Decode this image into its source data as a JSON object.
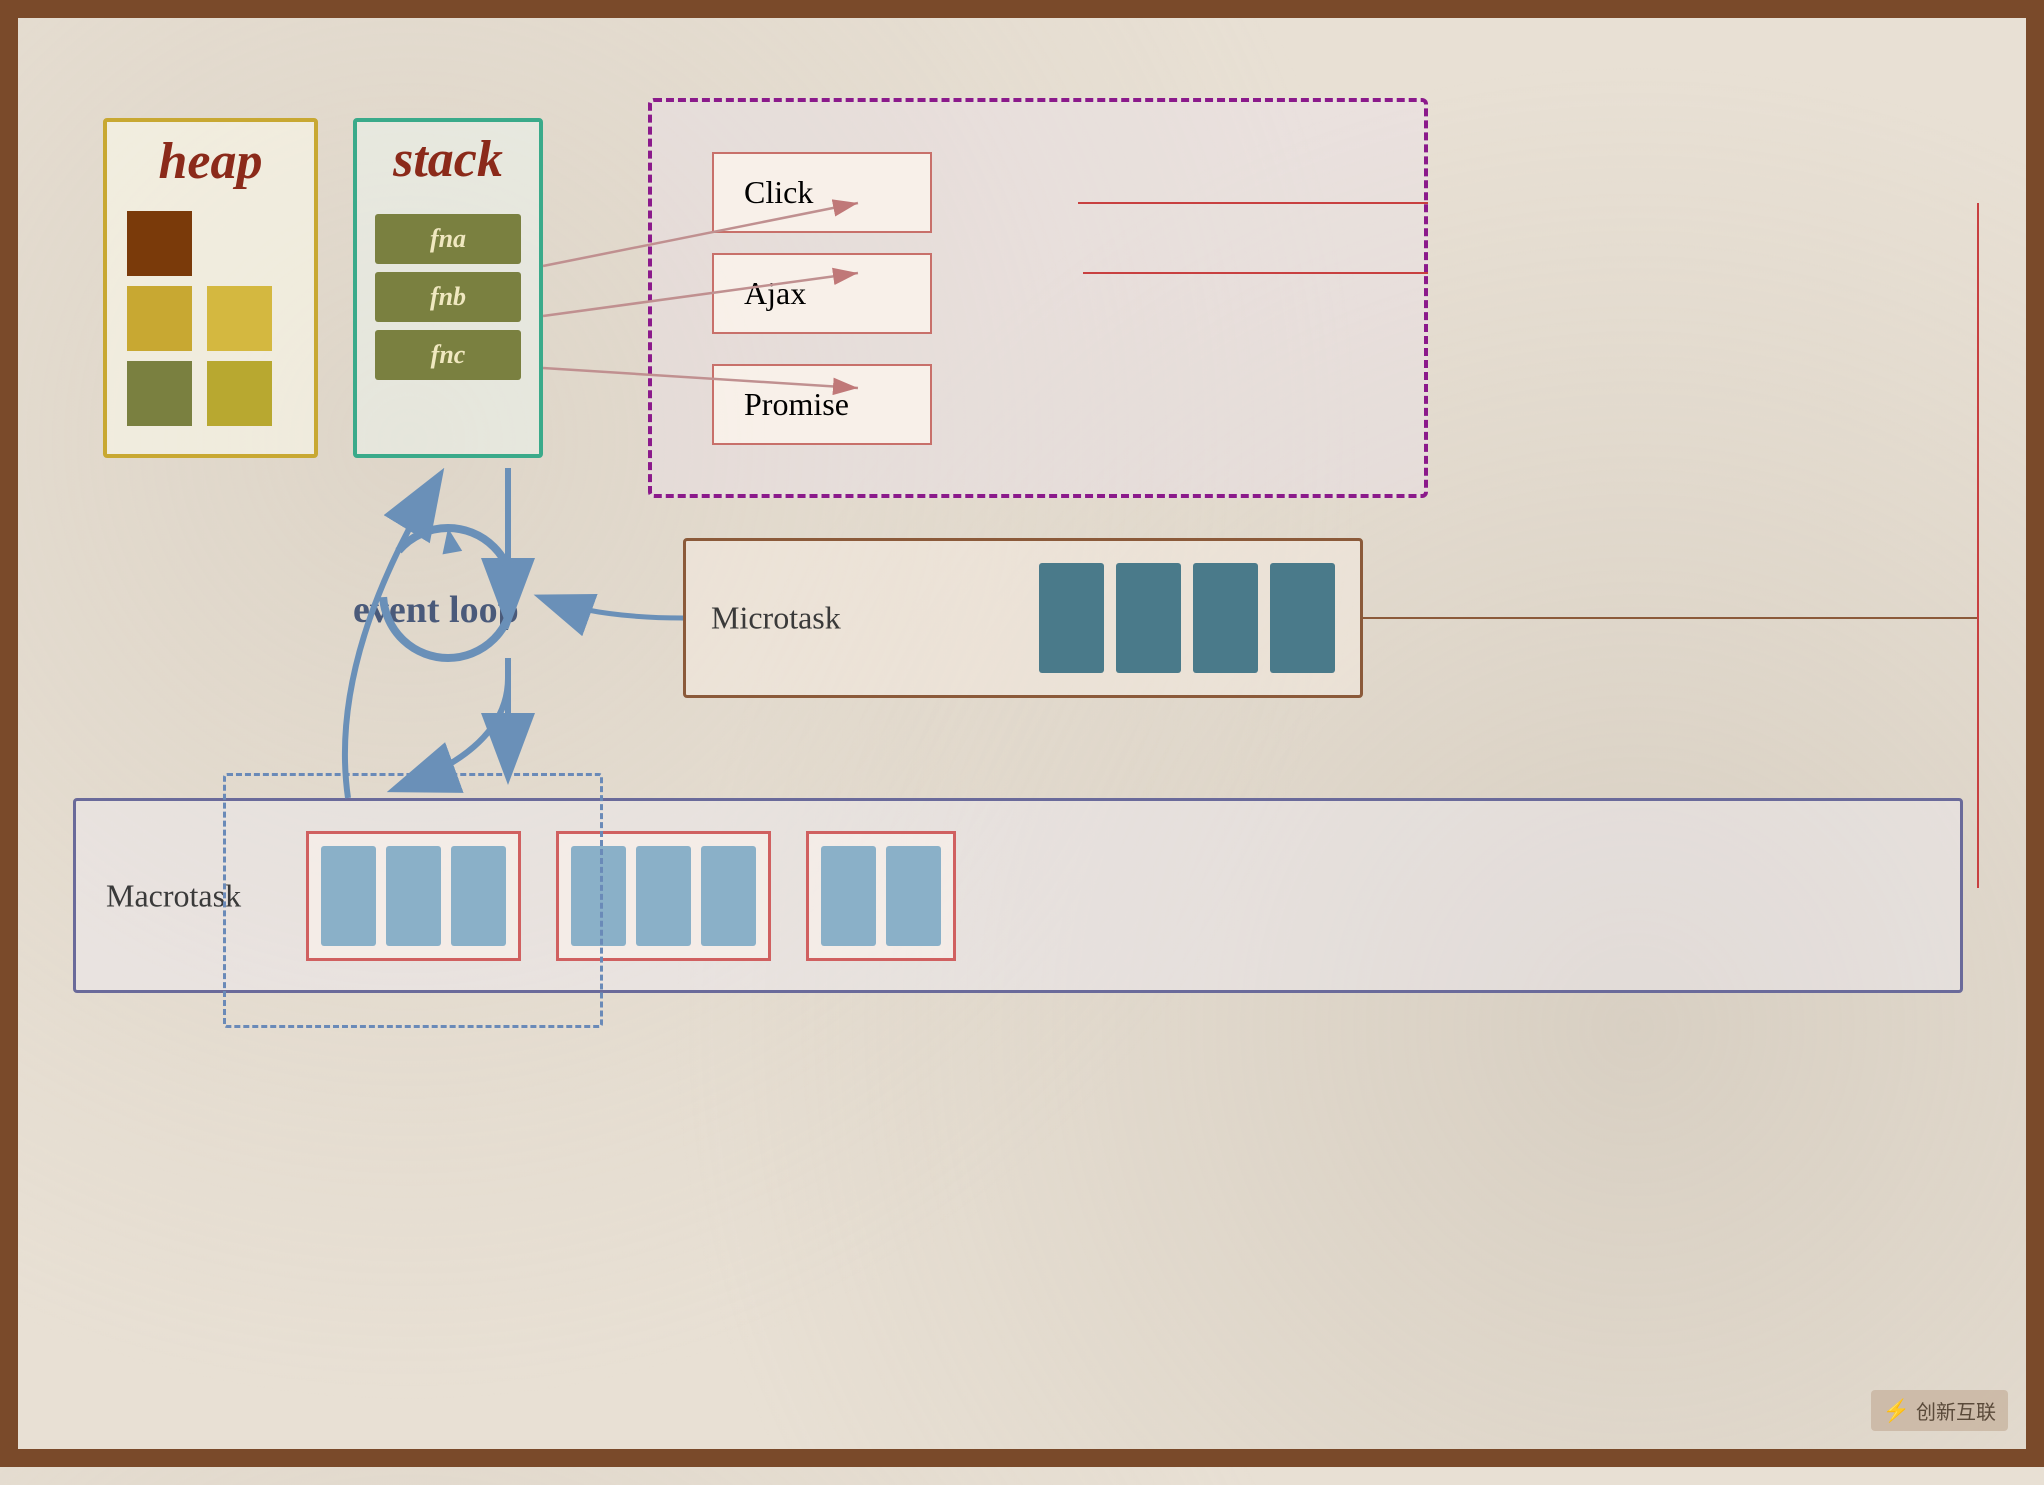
{
  "heap": {
    "title": "heap",
    "squares": [
      "brown",
      "gold1",
      "gold2",
      "olive1",
      "olive2"
    ]
  },
  "stack": {
    "title": "stack",
    "items": [
      "fna",
      "fnb",
      "fnc"
    ]
  },
  "webapi": {
    "items": [
      "Click",
      "Ajax",
      "Promise"
    ]
  },
  "microtask": {
    "label": "Microtask",
    "blocks": 4
  },
  "macrotask": {
    "label": "Macrotask",
    "groups": 3
  },
  "eventloop": {
    "label": "event loop"
  },
  "watermark": "创新互联"
}
